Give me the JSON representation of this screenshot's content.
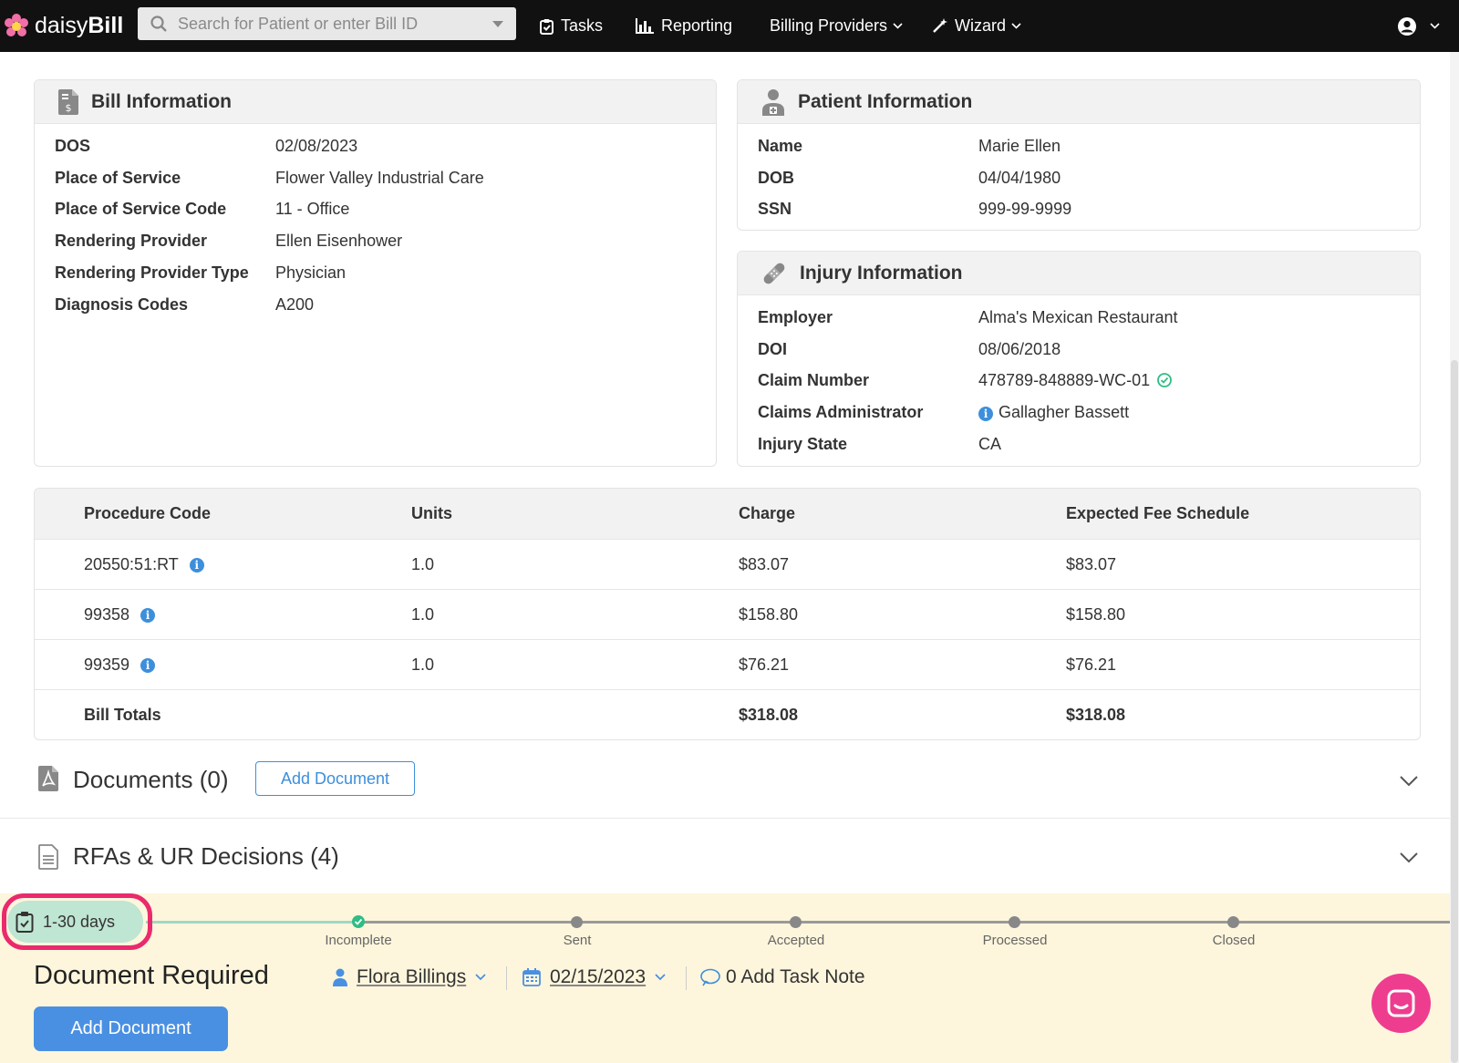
{
  "brand": {
    "name_light": "daisy",
    "name_bold": "Bill"
  },
  "search": {
    "placeholder": "Search for Patient or enter Bill ID"
  },
  "nav": {
    "tasks": "Tasks",
    "reporting": "Reporting",
    "billing_providers": "Billing Providers",
    "wizard": "Wizard"
  },
  "bill_info": {
    "title": "Bill Information",
    "fields": [
      {
        "label": "DOS",
        "value": "02/08/2023"
      },
      {
        "label": "Place of Service",
        "value": "Flower Valley Industrial Care"
      },
      {
        "label": "Place of Service Code",
        "value": "11 - Office"
      },
      {
        "label": "Rendering Provider",
        "value": "Ellen Eisenhower"
      },
      {
        "label": "Rendering Provider Type",
        "value": "Physician"
      },
      {
        "label": "Diagnosis Codes",
        "value": "A200"
      }
    ]
  },
  "patient_info": {
    "title": "Patient Information",
    "fields": [
      {
        "label": "Name",
        "value": "Marie Ellen"
      },
      {
        "label": "DOB",
        "value": "04/04/1980"
      },
      {
        "label": "SSN",
        "value": "999-99-9999"
      }
    ]
  },
  "injury_info": {
    "title": "Injury Information",
    "fields": [
      {
        "label": "Employer",
        "value": "Alma's Mexican Restaurant"
      },
      {
        "label": "DOI",
        "value": "08/06/2018"
      },
      {
        "label": "Claim Number",
        "value": "478789-848889-WC-01"
      },
      {
        "label": "Claims Administrator",
        "value": "Gallagher Bassett"
      },
      {
        "label": "Injury State",
        "value": "CA"
      }
    ]
  },
  "procedures": {
    "headers": [
      "Procedure Code",
      "Units",
      "Charge",
      "Expected Fee Schedule"
    ],
    "rows": [
      [
        "20550:51:RT",
        "1.0",
        "$83.07",
        "$83.07"
      ],
      [
        "99358",
        "1.0",
        "$158.80",
        "$158.80"
      ],
      [
        "99359",
        "1.0",
        "$76.21",
        "$76.21"
      ]
    ],
    "totals": {
      "label": "Bill Totals",
      "charge": "$318.08",
      "expected": "$318.08"
    }
  },
  "documents": {
    "title": "Documents (0)",
    "add_label": "Add Document"
  },
  "rfas": {
    "title": "RFAs & UR Decisions (4)"
  },
  "task": {
    "age": "1-30 days",
    "steps": [
      "Incomplete",
      "Sent",
      "Accepted",
      "Processed",
      "Closed"
    ],
    "title": "Document Required",
    "assignee": "Flora Billings",
    "due_date": "02/15/2023",
    "note_label": "0 Add Task Note",
    "add_label": "Add Document"
  },
  "colors": {
    "accent": "#3d8fdc",
    "highlight": "#ea2a6d",
    "task_bg": "#fdf6dc",
    "success": "#2ebd85"
  }
}
